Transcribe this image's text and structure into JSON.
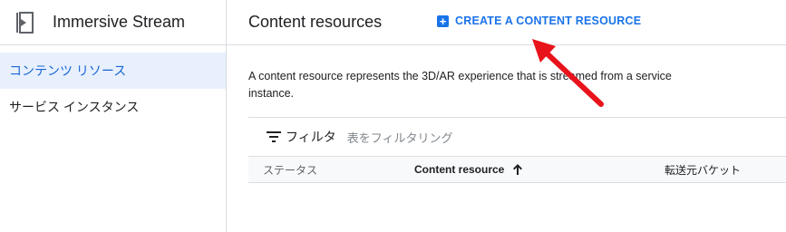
{
  "sidebar": {
    "product_title": "Immersive Stream",
    "product_icon": "immersive-stream-icon",
    "items": [
      {
        "label": "コンテンツ リソース",
        "active": true
      },
      {
        "label": "サービス インスタンス",
        "active": false
      }
    ]
  },
  "header": {
    "title": "Content resources",
    "create_label": "CREATE A CONTENT RESOURCE",
    "create_icon": "add-box-icon"
  },
  "main": {
    "description": "A content resource represents the 3D/AR experience that is streamed from a service instance."
  },
  "table": {
    "filter_label": "フィルタ",
    "filter_placeholder": "表をフィルタリング",
    "filter_icon": "filter-icon",
    "columns": [
      "ステータス",
      "Content resource",
      "転送元バケット"
    ],
    "sort_icon": "arrow-up-icon"
  },
  "colors": {
    "accent": "#1a73e8",
    "nav_active_bg": "#e8f0fe",
    "annotation_arrow": "#e8131b"
  }
}
